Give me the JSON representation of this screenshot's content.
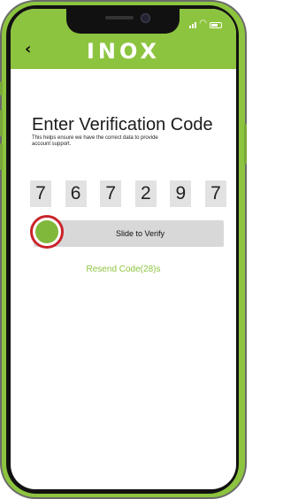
{
  "status_bar": {
    "signal_icon": "signal-bars-icon",
    "wifi_icon": "wifi-icon",
    "battery_icon": "battery-icon"
  },
  "header": {
    "back_icon": "chevron-left-icon",
    "back_glyph": "‹",
    "brand": "INOX",
    "color": "#8dc43f"
  },
  "verification": {
    "title": "Enter Verification Code",
    "subtitle": "This helps ensure we have the correct data to provide account support.",
    "code_digits": [
      "7",
      "6",
      "7",
      "2",
      "9",
      "7"
    ],
    "slider_label": "Slide to Verify",
    "resend_label": "Resend Code(28)s"
  },
  "colors": {
    "accent": "#8dc43f",
    "handle_ring": "#c9232a",
    "handle_fill": "#7fb83a"
  }
}
